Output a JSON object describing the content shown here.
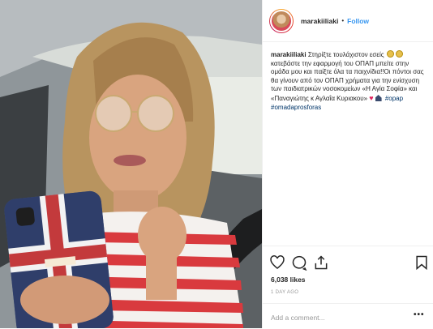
{
  "post": {
    "username": "marakiiliaki",
    "separator": "•",
    "follow_label": "Follow"
  },
  "caption": {
    "username": "marakiiliaki",
    "text_part1": "Στηρίξτε τουλάχιστον εσείς",
    "text_part2": "κατεβάστε την εφαρμογή του ΟΠΑΠ μπείτε στην ομάδα μου και παίξτε όλα τα παιχνίδια!!Οι πόντοι σας θα γίνουν από τον ΟΠΑΠ χρήματα για την ενίσχυση των παιδιατρικών νοσοκομείων «Η Αγία Σοφία» και «Παναγιώτης κ Αγλαΐα Κυριακου»",
    "hashtag1": "#opap",
    "hashtag2": "#omadaprosforas"
  },
  "stats": {
    "likes": "6,038 likes",
    "time": "1 DAY AGO"
  },
  "comment": {
    "placeholder": "Add a comment...",
    "more_label": "•••"
  },
  "icons": [
    "heart-icon",
    "comment-icon",
    "share-icon",
    "bookmark-icon",
    "face-emoji-icon",
    "heart-emoji-icon",
    "church-emoji-icon"
  ],
  "colors": {
    "link_blue": "#3897f0",
    "hashtag_navy": "#003569",
    "border": "#efefef",
    "muted": "#999999",
    "text": "#262626"
  }
}
